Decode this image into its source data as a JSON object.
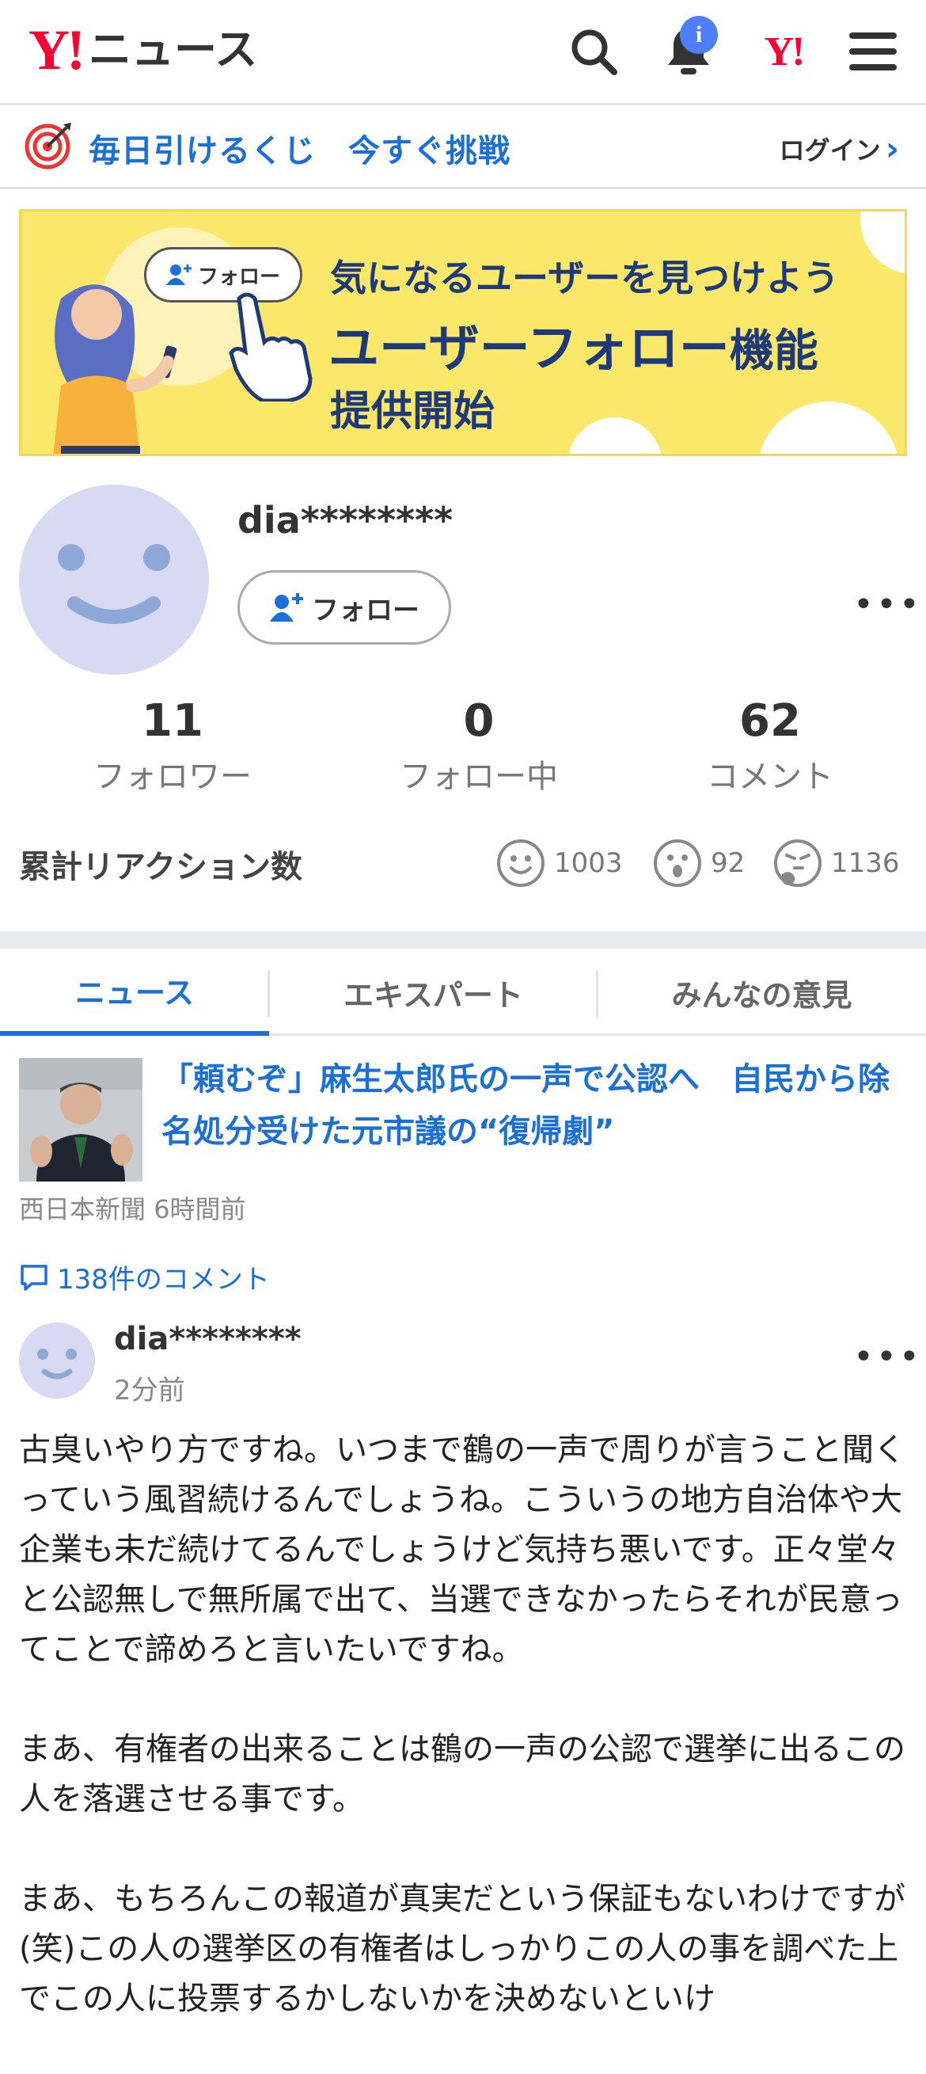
{
  "header": {
    "logo_mark": "Y!",
    "logo_text": "ニュース",
    "notification_badge": "i",
    "yahoo_mark": "Y!"
  },
  "campaign": {
    "text": "毎日引けるくじ　今すぐ挑戦",
    "login": "ログイン"
  },
  "banner": {
    "pill_label": "フォロー",
    "line1": "気になるユーザーを見つけよう",
    "line2_main": "ユーザーフォロー",
    "line2_suffix": "機能",
    "line3": "提供開始"
  },
  "profile": {
    "username": "dia********",
    "follow_label": "フォロー"
  },
  "stats": [
    {
      "value": "11",
      "label": "フォロワー"
    },
    {
      "value": "0",
      "label": "フォロー中"
    },
    {
      "value": "62",
      "label": "コメント"
    }
  ],
  "reactions": {
    "title": "累計リアクション数",
    "items": [
      {
        "icon": "smile-face-icon",
        "count": "1003"
      },
      {
        "icon": "surprised-face-icon",
        "count": "92"
      },
      {
        "icon": "thinking-face-icon",
        "count": "1136"
      }
    ]
  },
  "tabs": [
    {
      "label": "ニュース",
      "active": true
    },
    {
      "label": "エキスパート",
      "active": false
    },
    {
      "label": "みんなの意見",
      "active": false
    }
  ],
  "article": {
    "title": "「頼むぞ」麻生太郎氏の一声で公認へ　自民から除名処分受けた元市議の“復帰劇”",
    "source": "西日本新聞",
    "time": "6時間前",
    "comments_link": "138件のコメント"
  },
  "comment": {
    "username": "dia********",
    "time": "2分前",
    "paragraphs": [
      "古臭いやり方ですね。いつまで鶴の一声で周りが言うこと聞くっていう風習続けるんでしょうね。こういうの地方自治体や大企業も未だ続けてるんでしょうけど気持ち悪いです。正々堂々と公認無しで無所属で出て、当選できなかったらそれが民意ってことで諦めろと言いたいですね。",
      "まあ、有権者の出来ることは鶴の一声の公認で選挙に出るこの人を落選させる事です。",
      "まあ、もちろんこの報道が真実だという保証もないわけですが(笑)この人の選挙区の有権者はしっかりこの人の事を調べた上でこの人に投票するかしないかを決めないといけ"
    ]
  },
  "colors": {
    "accent": "#1a6fd8",
    "yahoo_red": "#ff0033",
    "banner_yellow": "#fbe86a"
  }
}
